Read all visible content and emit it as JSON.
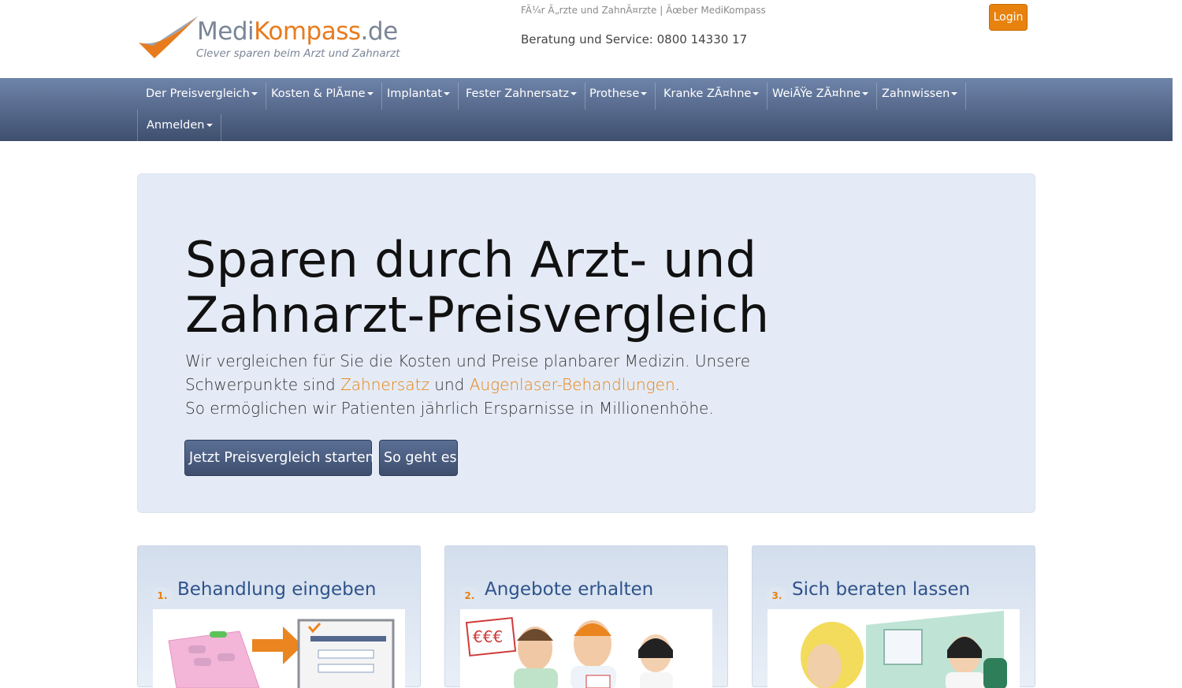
{
  "header": {
    "logo_medi": "Medi",
    "logo_kompass": "Kompass",
    "logo_de": ".de",
    "logo_tagline": "Clever sparen beim Arzt und Zahnarzt",
    "toplink_doctors": "FÃ¼r Ã„rzte und ZahnÃ¤rzte",
    "toplink_separator": "|",
    "toplink_about": "Ãœber MediKompass",
    "hotline": "Beratung und Service: 0800 14330 17",
    "login_label": "Login"
  },
  "nav": {
    "items": [
      {
        "label": "Der Preisvergleich"
      },
      {
        "label": "Kosten & PlÃ¤ne"
      },
      {
        "label": "Implantat"
      },
      {
        "label": "Fester Zahnersatz"
      },
      {
        "label": "Prothese"
      },
      {
        "label": "Kranke ZÃ¤hne"
      },
      {
        "label": "WeiÃŸe ZÃ¤hne"
      },
      {
        "label": "Zahnwissen"
      },
      {
        "label": "Anmelden"
      }
    ]
  },
  "hero": {
    "title_line1": "Sparen durch Arzt- und",
    "title_line2": "Zahnarzt-Preisvergleich",
    "text_line1": "Wir vergleichen für Sie die Kosten und Preise planbarer Medizin. Unsere",
    "text_line2_pre": "Schwerpunkte sind ",
    "link_zahnersatz": "Zahnersatz",
    "text_line2_mid": " und ",
    "link_augenlaser": "Augenlaser-Behandlungen",
    "text_line2_post": ".",
    "text_line3": "So ermöglichen wir Patienten jährlich Ersparnisse in Millionenhöhe.",
    "btn_start": "Jetzt Preisvergleich starten",
    "btn_how": "So geht es"
  },
  "steps": [
    {
      "num": "1.",
      "title": "Behandlung eingeben"
    },
    {
      "num": "2.",
      "title": "Angebote erhalten"
    },
    {
      "num": "3.",
      "title": "Sich beraten lassen"
    }
  ],
  "images": {
    "step2_price_tag": "€€€"
  },
  "colors": {
    "accent_orange": "#e8820f",
    "nav_top": "#6f84aa",
    "nav_bottom": "#3e4f6e",
    "hero_bg": "#e4ebf6",
    "step_title": "#2f538b"
  }
}
